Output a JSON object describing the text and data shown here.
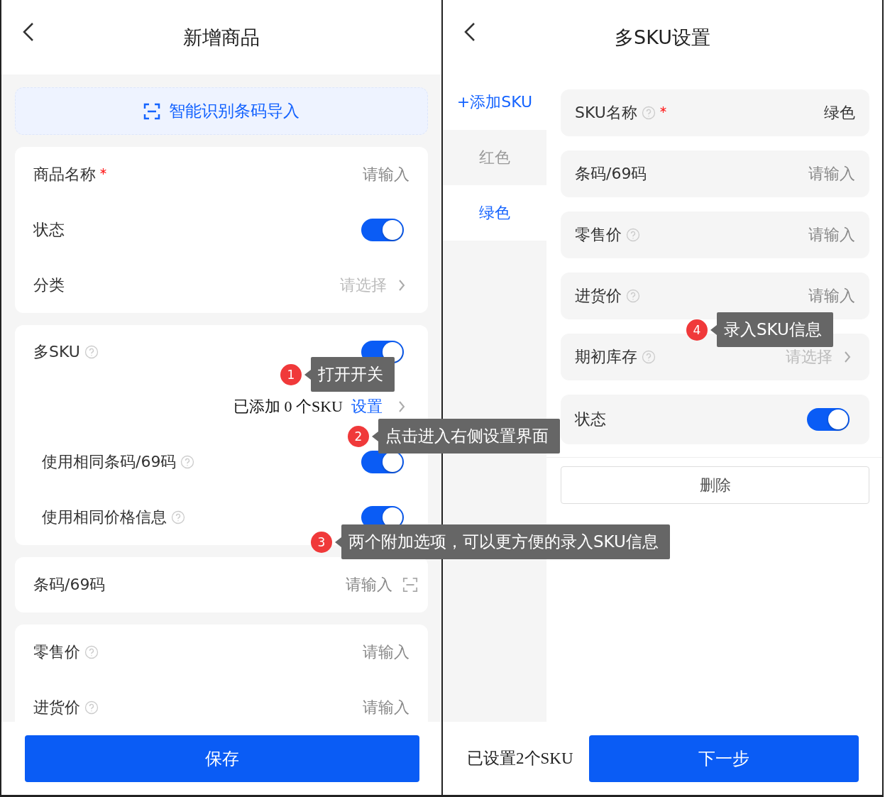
{
  "left": {
    "title": "新增商品",
    "scan_button": "智能识别条码导入",
    "group1": [
      {
        "kind": "input",
        "label": "商品名称",
        "required": true,
        "placeholder": "请输入"
      },
      {
        "kind": "switch",
        "label": "状态",
        "on": true
      },
      {
        "kind": "select",
        "label": "分类",
        "placeholder": "请选择"
      }
    ],
    "sku_group": {
      "label": "多SKU",
      "help": true,
      "on": true,
      "added_text": "已添加 0 个SKU",
      "link": "设置",
      "options": [
        {
          "label": "使用相同条码/69码",
          "help": true,
          "on": true
        },
        {
          "label": "使用相同价格信息",
          "help": true,
          "on": true
        }
      ]
    },
    "barcode": {
      "label": "条码/69码",
      "placeholder": "请输入"
    },
    "group3": [
      {
        "kind": "input",
        "label": "零售价",
        "help": true,
        "placeholder": "请输入"
      },
      {
        "kind": "input",
        "label": "进货价",
        "help": true,
        "placeholder": "请输入"
      }
    ],
    "save_button": "保存"
  },
  "right": {
    "title": "多SKU设置",
    "add_sku": "+添加SKU",
    "sku_tabs": [
      {
        "label": "红色",
        "selected": false
      },
      {
        "label": "绿色",
        "selected": true
      }
    ],
    "fields": [
      {
        "kind": "value",
        "label": "SKU名称",
        "required": true,
        "help": true,
        "value": "绿色"
      },
      {
        "kind": "input",
        "label": "条码/69码",
        "placeholder": "请输入"
      },
      {
        "kind": "input",
        "label": "零售价",
        "help": true,
        "placeholder": "请输入"
      },
      {
        "kind": "input",
        "label": "进货价",
        "help": true,
        "placeholder": "请输入"
      },
      {
        "kind": "select",
        "label": "期初库存",
        "help": true,
        "placeholder": "请选择"
      },
      {
        "kind": "switch",
        "label": "状态",
        "on": true
      }
    ],
    "delete_button": "删除",
    "summary": "已设置2个SKU",
    "next_button": "下一步"
  },
  "annotations": [
    {
      "number": "1",
      "text": "打开开关"
    },
    {
      "number": "2",
      "text": "点击进入右侧设置界面"
    },
    {
      "number": "3",
      "text": "两个附加选项，可以更方便的录入SKU信息"
    },
    {
      "number": "4",
      "text": "录入SKU信息"
    }
  ]
}
